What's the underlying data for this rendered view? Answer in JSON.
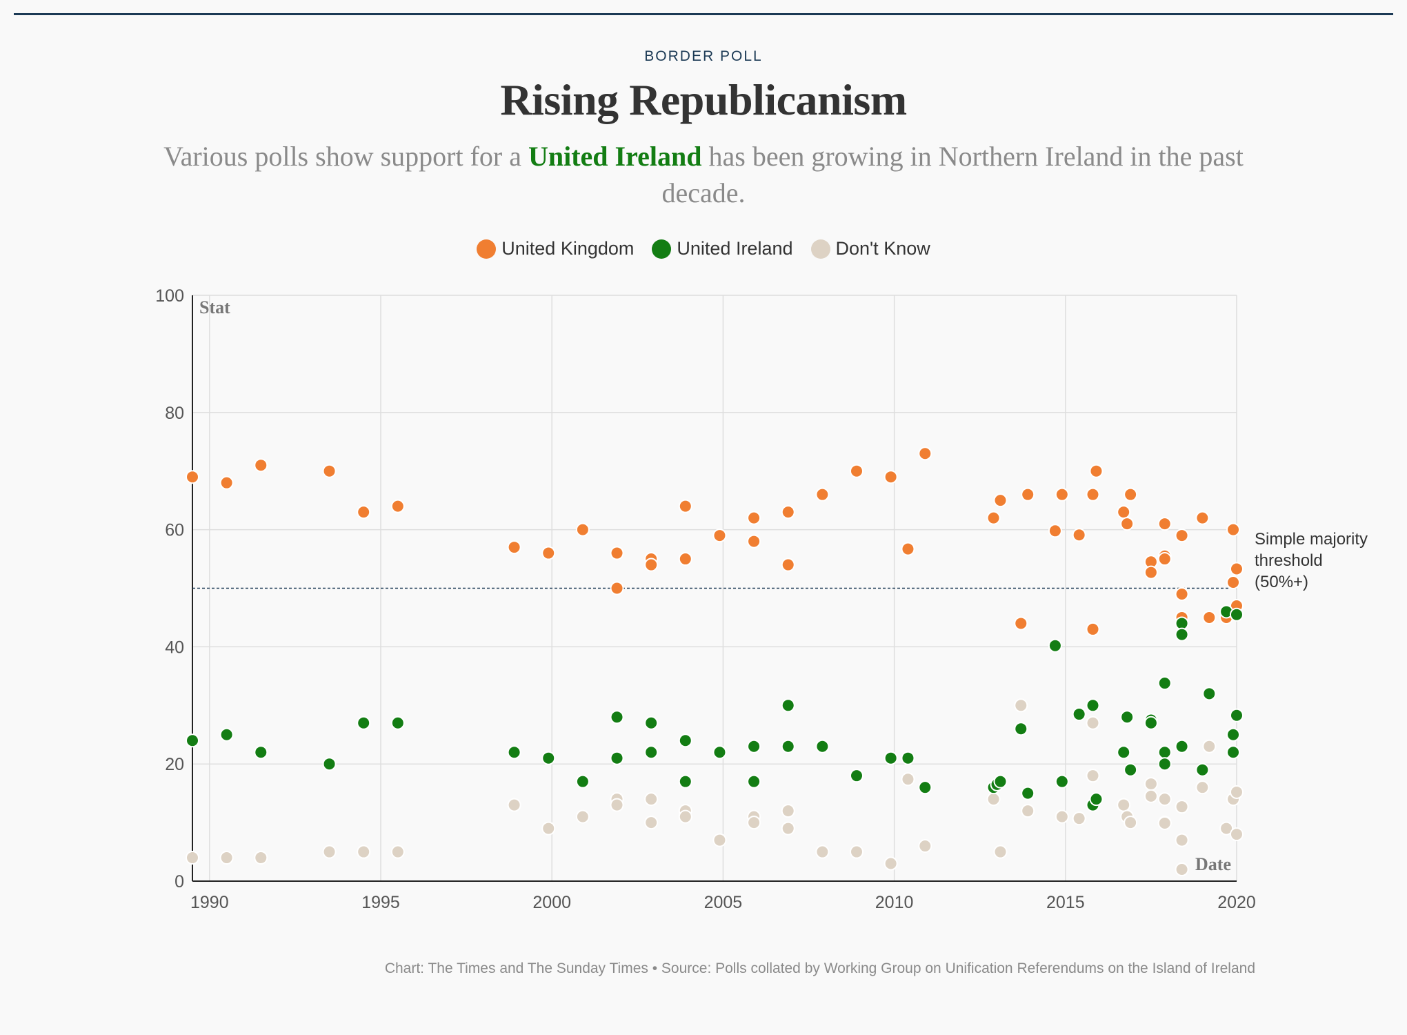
{
  "header": {
    "kicker": "BORDER POLL",
    "title": "Rising Republicanism",
    "subtitle_before": "Various polls show support for a ",
    "subtitle_highlight": "United Ireland",
    "subtitle_after": " has been growing in Northern Ireland in the past decade."
  },
  "footer": {
    "credit": "Chart: The Times and The Sunday Times • Source: Polls collated by Working Group on Unification Referendums on the Island of Ireland"
  },
  "colors": {
    "uk": "#f07e31",
    "ui": "#137d13",
    "dk": "#ddd2c4",
    "accent": "#1c3a55"
  },
  "chart_data": {
    "type": "scatter",
    "title": "Rising Republicanism",
    "xlabel": "Date",
    "ylabel": "Stat",
    "xlim": [
      1989.5,
      2020
    ],
    "ylim": [
      0,
      100
    ],
    "x_ticks": [
      1990,
      1995,
      2000,
      2005,
      2010,
      2015,
      2020
    ],
    "y_ticks": [
      0,
      20,
      40,
      60,
      80,
      100
    ],
    "grid": true,
    "legend_position": "top-center",
    "threshold": {
      "value": 50,
      "label_lines": [
        "Simple majority",
        "threshold",
        "(50%+)"
      ]
    },
    "series": [
      {
        "name": "United Kingdom",
        "color_key": "uk",
        "points": [
          [
            1989.5,
            69
          ],
          [
            1990.5,
            68
          ],
          [
            1991.5,
            71
          ],
          [
            1993.5,
            70
          ],
          [
            1994.5,
            63
          ],
          [
            1995.5,
            64
          ],
          [
            1998.9,
            57
          ],
          [
            1999.9,
            56
          ],
          [
            2000.9,
            60
          ],
          [
            2001.9,
            56
          ],
          [
            2001.9,
            50
          ],
          [
            2002.9,
            55
          ],
          [
            2002.9,
            54
          ],
          [
            2003.9,
            64
          ],
          [
            2003.9,
            55
          ],
          [
            2004.9,
            59
          ],
          [
            2005.9,
            62
          ],
          [
            2005.9,
            58
          ],
          [
            2006.9,
            63
          ],
          [
            2006.9,
            54
          ],
          [
            2007.9,
            66
          ],
          [
            2008.9,
            70
          ],
          [
            2009.9,
            69
          ],
          [
            2010.4,
            56.7
          ],
          [
            2010.9,
            73
          ],
          [
            2012.9,
            62
          ],
          [
            2013.1,
            65
          ],
          [
            2013.7,
            44
          ],
          [
            2013.9,
            66
          ],
          [
            2014.7,
            59.8
          ],
          [
            2014.9,
            66
          ],
          [
            2015.4,
            59.1
          ],
          [
            2015.8,
            66
          ],
          [
            2015.8,
            43
          ],
          [
            2015.9,
            70
          ],
          [
            2016.7,
            63
          ],
          [
            2016.8,
            61
          ],
          [
            2016.9,
            66
          ],
          [
            2017.5,
            54.5
          ],
          [
            2017.5,
            52.7
          ],
          [
            2017.9,
            55.5
          ],
          [
            2017.9,
            55
          ],
          [
            2017.9,
            61
          ],
          [
            2018.4,
            59
          ],
          [
            2018.4,
            49
          ],
          [
            2018.4,
            45
          ],
          [
            2019.0,
            62
          ],
          [
            2019.2,
            45
          ],
          [
            2019.7,
            45
          ],
          [
            2019.9,
            51
          ],
          [
            2019.9,
            60
          ],
          [
            2020.0,
            53.3
          ],
          [
            2020.0,
            47
          ]
        ]
      },
      {
        "name": "United Ireland",
        "color_key": "ui",
        "points": [
          [
            1989.5,
            24
          ],
          [
            1990.5,
            25
          ],
          [
            1991.5,
            22
          ],
          [
            1993.5,
            20
          ],
          [
            1994.5,
            27
          ],
          [
            1995.5,
            27
          ],
          [
            1998.9,
            22
          ],
          [
            1999.9,
            21
          ],
          [
            2000.9,
            17
          ],
          [
            2001.9,
            28
          ],
          [
            2001.9,
            21
          ],
          [
            2002.9,
            27
          ],
          [
            2002.9,
            22
          ],
          [
            2003.9,
            24
          ],
          [
            2003.9,
            17
          ],
          [
            2004.9,
            22
          ],
          [
            2005.9,
            23
          ],
          [
            2005.9,
            17
          ],
          [
            2006.9,
            30
          ],
          [
            2006.9,
            23
          ],
          [
            2007.9,
            23
          ],
          [
            2008.9,
            18
          ],
          [
            2009.9,
            21
          ],
          [
            2010.4,
            21
          ],
          [
            2010.9,
            16
          ],
          [
            2012.9,
            16
          ],
          [
            2013.0,
            16.5
          ],
          [
            2013.1,
            17
          ],
          [
            2013.7,
            26
          ],
          [
            2013.9,
            15
          ],
          [
            2014.7,
            40.2
          ],
          [
            2014.9,
            17
          ],
          [
            2015.4,
            28.5
          ],
          [
            2015.8,
            30
          ],
          [
            2015.8,
            13
          ],
          [
            2015.9,
            14
          ],
          [
            2016.7,
            22
          ],
          [
            2016.8,
            28
          ],
          [
            2016.9,
            19
          ],
          [
            2017.5,
            27.5
          ],
          [
            2017.5,
            27
          ],
          [
            2017.9,
            33.8
          ],
          [
            2017.9,
            22
          ],
          [
            2017.9,
            20
          ],
          [
            2018.4,
            23
          ],
          [
            2018.4,
            44
          ],
          [
            2018.4,
            42.1
          ],
          [
            2019.0,
            19
          ],
          [
            2019.2,
            32
          ],
          [
            2019.7,
            46
          ],
          [
            2019.9,
            25
          ],
          [
            2019.9,
            22
          ],
          [
            2020.0,
            28.3
          ],
          [
            2020.0,
            45.5
          ]
        ]
      },
      {
        "name": "Don't Know",
        "color_key": "dk",
        "points": [
          [
            1989.5,
            4
          ],
          [
            1990.5,
            4
          ],
          [
            1991.5,
            4
          ],
          [
            1993.5,
            5
          ],
          [
            1994.5,
            5
          ],
          [
            1995.5,
            5
          ],
          [
            1998.9,
            13
          ],
          [
            1999.9,
            9
          ],
          [
            2000.9,
            11
          ],
          [
            2001.9,
            14
          ],
          [
            2001.9,
            13
          ],
          [
            2002.9,
            14
          ],
          [
            2002.9,
            10
          ],
          [
            2003.9,
            12
          ],
          [
            2003.9,
            11
          ],
          [
            2004.9,
            7
          ],
          [
            2005.9,
            11
          ],
          [
            2005.9,
            10
          ],
          [
            2006.9,
            12
          ],
          [
            2006.9,
            9
          ],
          [
            2007.9,
            5
          ],
          [
            2008.9,
            5
          ],
          [
            2009.9,
            3
          ],
          [
            2010.4,
            17.4
          ],
          [
            2010.9,
            6
          ],
          [
            2012.9,
            14
          ],
          [
            2013.1,
            5
          ],
          [
            2013.7,
            30
          ],
          [
            2013.9,
            12
          ],
          [
            2014.9,
            11
          ],
          [
            2015.4,
            10.7
          ],
          [
            2015.8,
            27
          ],
          [
            2015.8,
            18
          ],
          [
            2016.7,
            13
          ],
          [
            2016.8,
            11
          ],
          [
            2016.9,
            10
          ],
          [
            2017.5,
            16.6
          ],
          [
            2017.5,
            14.5
          ],
          [
            2017.9,
            14
          ],
          [
            2017.9,
            10
          ],
          [
            2017.9,
            9.9
          ],
          [
            2018.4,
            12.7
          ],
          [
            2018.4,
            7
          ],
          [
            2018.4,
            2
          ],
          [
            2019.0,
            16
          ],
          [
            2019.2,
            23
          ],
          [
            2019.7,
            9
          ],
          [
            2019.9,
            14
          ],
          [
            2020.0,
            15.2
          ],
          [
            2020.0,
            8
          ]
        ]
      }
    ]
  }
}
